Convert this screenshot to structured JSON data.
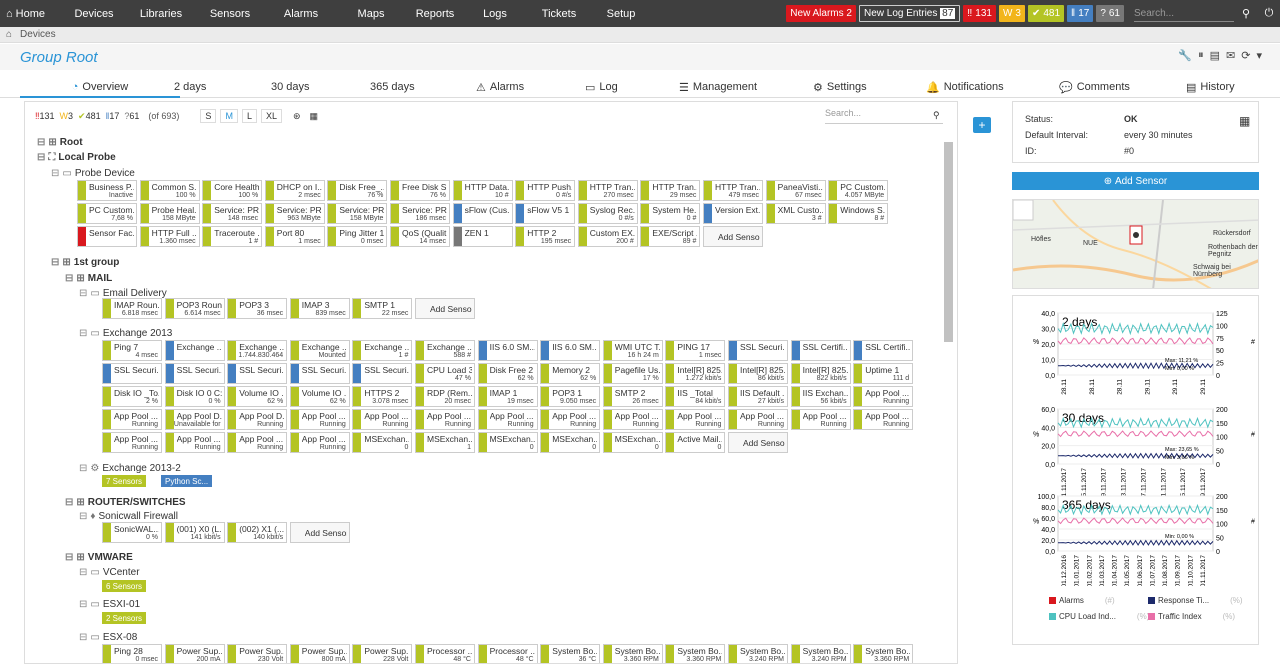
{
  "nav": {
    "home": "Home",
    "items": [
      "Devices",
      "Libraries",
      "Sensors",
      "Alarms",
      "Maps",
      "Reports",
      "Logs",
      "Tickets",
      "Setup"
    ],
    "new_alarms_label": "New Alarms",
    "new_alarms_count": "2",
    "new_log_label": "New Log Entries",
    "new_log_count": "87",
    "counts": [
      {
        "icon": "‼",
        "value": "131",
        "color": "#d9181e"
      },
      {
        "icon": "W",
        "value": "3",
        "color": "#f2b51b"
      },
      {
        "icon": "✔",
        "value": "481",
        "color": "#b4c424"
      },
      {
        "icon": "‖",
        "value": "17",
        "color": "#447fc1"
      },
      {
        "icon": "?",
        "value": "61",
        "color": "#777777"
      }
    ],
    "search_placeholder": "Search..."
  },
  "breadcrumb": {
    "item": "Devices"
  },
  "page": {
    "title": "Group Root"
  },
  "tabs": [
    "Overview",
    "2 days",
    "30 days",
    "365 days",
    "Alarms",
    "Log",
    "Management",
    "Settings",
    "Notifications",
    "Comments",
    "History"
  ],
  "toolbar": {
    "counts": [
      {
        "icon": "‼",
        "value": "131"
      },
      {
        "icon": "W",
        "value": "3"
      },
      {
        "icon": "✔",
        "value": "481"
      },
      {
        "icon": "‖",
        "value": "17"
      },
      {
        "icon": "?",
        "value": "61"
      }
    ],
    "total": "(of 693)",
    "sizes": [
      "S",
      "M",
      "L",
      "XL"
    ],
    "search_placeholder": "Search..."
  },
  "tree": {
    "root": "Root",
    "local_probe": "Local Probe",
    "probe_device": "Probe Device",
    "first_group": "1st group",
    "mail": "MAIL",
    "email_delivery": "Email Delivery",
    "exchange2013": "Exchange 2013",
    "exchange2013_2": "Exchange 2013-2",
    "exchange2013_2_pills": [
      "7 Sensors",
      "Python Sc..."
    ],
    "router": "ROUTER/SWITCHES",
    "sonicwall": "Sonicwall Firewall",
    "vmware": "VMWARE",
    "vcenter": "VCenter",
    "vcenter_pill": "6 Sensors",
    "esxi01": "ESXI-01",
    "esxi01_pill": "2 Sensors",
    "esx08": "ESX-08"
  },
  "tiles": {
    "probe_row1": [
      [
        "Business P...",
        "Inactive"
      ],
      [
        "Common S...",
        "100 %"
      ],
      [
        "Core Health",
        "100 %"
      ],
      [
        "DHCP on I...",
        "2 msec"
      ],
      [
        "Disk Free_...",
        "76 %"
      ],
      [
        "Free Disk S...",
        "76 %"
      ],
      [
        "HTTP Data...",
        "10 #"
      ],
      [
        "HTTP Push...",
        "0 #/s"
      ],
      [
        "HTTP Tran...",
        "270 msec"
      ],
      [
        "HTTP Tran...",
        "29 msec"
      ],
      [
        "HTTP Tran...",
        "479 msec"
      ],
      [
        "PaneaVisti...",
        "67 msec"
      ],
      [
        "PC Custom...",
        "4.057 MByte"
      ]
    ],
    "probe_row2": [
      [
        "PC Custom...",
        "7,68 %"
      ],
      [
        "Probe Heal...",
        "158 MByte"
      ],
      [
        "Service: PR...",
        "148 msec"
      ],
      [
        "Service: PR...",
        "963 MByte"
      ],
      [
        "Service: PR...",
        "158 MByte"
      ],
      [
        "Service: PR...",
        "186 msec"
      ],
      [
        "sFlow (Cus...",
        ""
      ],
      [
        "sFlow V5 1",
        ""
      ],
      [
        "Syslog Rec...",
        "0 #/s"
      ],
      [
        "System He...",
        "0 #"
      ],
      [
        "Version Ext...",
        ""
      ],
      [
        "XML Custo...",
        "3 #"
      ],
      [
        "Windows S...",
        "8 #"
      ]
    ],
    "probe_row3": [
      [
        "Sensor Fac...",
        ""
      ],
      [
        "HTTP Full ...",
        "1.360 msec"
      ],
      [
        "Traceroute ...",
        "1 #"
      ],
      [
        "Port 80",
        "1 msec"
      ],
      [
        "Ping Jitter 1",
        "0 msec"
      ],
      [
        "QoS (Qualit...",
        "14 msec"
      ],
      [
        "ZEN 1",
        ""
      ],
      [
        "HTTP 2",
        "195 msec"
      ],
      [
        "Custom EX...",
        "200 #"
      ],
      [
        "EXE/Script ...",
        "89 #"
      ],
      [
        "Add Sensor",
        ""
      ]
    ],
    "email_row": [
      [
        "IMAP Roun...",
        "6.818 msec"
      ],
      [
        "POP3 Roun...",
        "6.614 msec"
      ],
      [
        "POP3 3",
        "36 msec"
      ],
      [
        "IMAP 3",
        "839 msec"
      ],
      [
        "SMTP 1",
        "22 msec"
      ],
      [
        "Add Sensor",
        ""
      ]
    ],
    "ex_row1": [
      [
        "Ping 7",
        "4 msec"
      ],
      [
        "Exchange ...",
        ""
      ],
      [
        "Exchange ...",
        "1.744.830.464"
      ],
      [
        "Exchange ...",
        "Mounted"
      ],
      [
        "Exchange ...",
        "1 #"
      ],
      [
        "Exchange ...",
        "588 #"
      ],
      [
        "IIS 6.0 SM...",
        ""
      ],
      [
        "IIS 6.0 SM...",
        ""
      ],
      [
        "WMI UTC T...",
        "16 h 24 m"
      ],
      [
        "PING 17",
        "1 msec"
      ],
      [
        "SSL Securi...",
        ""
      ],
      [
        "SSL Certifi...",
        ""
      ],
      [
        "SSL Certifi...",
        ""
      ]
    ],
    "ex_row2": [
      [
        "SSL Securi...",
        ""
      ],
      [
        "SSL Securi...",
        ""
      ],
      [
        "SSL Securi...",
        ""
      ],
      [
        "SSL Securi...",
        ""
      ],
      [
        "SSL Securi...",
        ""
      ],
      [
        "CPU Load 3",
        "47 %"
      ],
      [
        "Disk Free 2",
        "62 %"
      ],
      [
        "Memory 2",
        "62 %"
      ],
      [
        "Pagefile Us...",
        "17 %"
      ],
      [
        "Intel[R] 825...",
        "1.272 kbit/s"
      ],
      [
        "Intel[R] 825...",
        "86 kbit/s"
      ],
      [
        "Intel[R] 825...",
        "822 kbit/s"
      ],
      [
        "Uptime 1",
        "111 d"
      ]
    ],
    "ex_row3": [
      [
        "Disk IO _To...",
        "2 %"
      ],
      [
        "Disk IO 0 C:",
        "0 %"
      ],
      [
        "Volume IO ...",
        "62 %"
      ],
      [
        "Volume IO ...",
        "62 %"
      ],
      [
        "HTTPS 2",
        "3.078 msec"
      ],
      [
        "RDP (Rem...",
        "20 msec"
      ],
      [
        "IMAP 1",
        "19 msec"
      ],
      [
        "POP3 1",
        "9.050 msec"
      ],
      [
        "SMTP 2",
        "26 msec"
      ],
      [
        "IIS _Total",
        "84 kbit/s"
      ],
      [
        "IIS Default ...",
        "27 kbit/s"
      ],
      [
        "IIS Exchan...",
        "56 kbit/s"
      ],
      [
        "App Pool ...",
        "Running"
      ]
    ],
    "ex_row4": [
      [
        "App Pool ...",
        "Running"
      ],
      [
        "App Pool D...",
        "Unavailable for"
      ],
      [
        "App Pool D...",
        "Running"
      ],
      [
        "App Pool ...",
        "Running"
      ],
      [
        "App Pool ...",
        "Running"
      ],
      [
        "App Pool ...",
        "Running"
      ],
      [
        "App Pool ...",
        "Running"
      ],
      [
        "App Pool ...",
        "Running"
      ],
      [
        "App Pool ...",
        "Running"
      ],
      [
        "App Pool ...",
        "Running"
      ],
      [
        "App Pool ...",
        "Running"
      ],
      [
        "App Pool ...",
        "Running"
      ],
      [
        "App Pool ...",
        "Running"
      ]
    ],
    "ex_row5": [
      [
        "App Pool ...",
        "Running"
      ],
      [
        "App Pool ...",
        "Running"
      ],
      [
        "App Pool ...",
        "Running"
      ],
      [
        "App Pool ...",
        "Running"
      ],
      [
        "MSExchan...",
        "0"
      ],
      [
        "MSExchan...",
        "1"
      ],
      [
        "MSExchan...",
        "0"
      ],
      [
        "MSExchan...",
        "0"
      ],
      [
        "MSExchan...",
        "0"
      ],
      [
        "Active Mail...",
        "0"
      ],
      [
        "Add Sensor",
        ""
      ]
    ],
    "sonic_row": [
      [
        "SonicWAL...",
        "0 %"
      ],
      [
        "(001) X0 (L...",
        "141 kbit/s"
      ],
      [
        "(002) X1 (...",
        "140 kbit/s"
      ],
      [
        "Add Sensor",
        ""
      ]
    ],
    "esx_row": [
      [
        "Ping 28",
        "0 msec"
      ],
      [
        "Power Sup...",
        "200 mA"
      ],
      [
        "Power Sup...",
        "230 Volt"
      ],
      [
        "Power Sup...",
        "800 mA"
      ],
      [
        "Power Sup...",
        "228 Volt"
      ],
      [
        "Processor ...",
        "48 °C"
      ],
      [
        "Processor ...",
        "48 °C"
      ],
      [
        "System Bo...",
        "36 °C"
      ],
      [
        "System Bo...",
        "3.360 RPM"
      ],
      [
        "System Bo...",
        "3.360 RPM"
      ],
      [
        "System Bo...",
        "3.240 RPM"
      ],
      [
        "System Bo...",
        "3.240 RPM"
      ],
      [
        "System Bo...",
        "3.360 RPM"
      ]
    ]
  },
  "status": {
    "status_label": "Status:",
    "status_value": "OK",
    "interval_label": "Default Interval:",
    "interval_value": "every  30 minutes",
    "id_label": "ID:",
    "id_value": "#0"
  },
  "add_sensor": "Add Sensor",
  "map": {
    "labels": [
      "Höfles",
      "NUE",
      "Rückersdorf",
      "Rothenbach der Pegnitz",
      "Schwaig bei Nürnberg"
    ]
  },
  "charts": [
    {
      "title": "2 days",
      "y_ticks": [
        "40,0",
        "30,0",
        "20,0",
        "10,0",
        "0,0"
      ],
      "y2_ticks": [
        "125",
        "100",
        "75",
        "50",
        "25",
        "0"
      ],
      "x_ticks": [
        "28.11",
        "28.11",
        "28.11",
        "29.11",
        "29.11",
        "29.11"
      ],
      "notes": [
        "Max: 11,21 %",
        "Min: 0,00 %"
      ],
      "ylabel": "%",
      "y2label": "#"
    },
    {
      "title": "30 days",
      "y_ticks": [
        "60,0",
        "40,0",
        "20,0",
        "0,0"
      ],
      "y2_ticks": [
        "200",
        "150",
        "100",
        "50",
        "0"
      ],
      "x_ticks": [
        "01.11.2017",
        "05.11.2017",
        "09.11.2017",
        "13.11.2017",
        "17.11.2017",
        "21.11.2017",
        "25.11.2017",
        "29.11.2017"
      ],
      "notes": [
        "Max: 23,65 %",
        "Min: 3,66 %"
      ],
      "ylabel": "%",
      "y2label": "#"
    },
    {
      "title": "365 days",
      "y_ticks": [
        "100,0",
        "80,0",
        "60,0",
        "40,0",
        "20,0",
        "0,0"
      ],
      "y2_ticks": [
        "200",
        "150",
        "100",
        "50",
        "0"
      ],
      "x_ticks": [
        "01.12.2016",
        "01.01.2017",
        "01.02.2017",
        "01.03.2017",
        "01.04.2017",
        "01.05.2017",
        "01.06.2017",
        "01.07.2017",
        "01.08.2017",
        "01.09.2017",
        "01.10.2017",
        "01.11.2017"
      ],
      "notes": [
        "Min: 0,00 %"
      ],
      "ylabel": "%",
      "y2label": "#"
    }
  ],
  "legend": [
    {
      "name": "Alarms",
      "unit": "(#)",
      "color": "#d9181e"
    },
    {
      "name": "Response Ti...",
      "unit": "(%)",
      "color": "#1d2a6b"
    },
    {
      "name": "CPU Load Ind...",
      "unit": "(%)",
      "color": "#4ec2c0"
    },
    {
      "name": "Traffic Index",
      "unit": "(%)",
      "color": "#e86fa8"
    }
  ]
}
